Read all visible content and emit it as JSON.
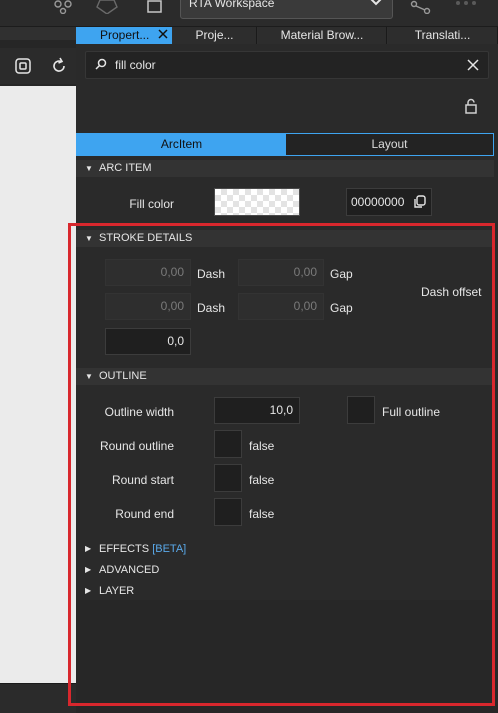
{
  "header": {
    "workspace_label": "RTA Workspace",
    "icons": [
      "network-icon",
      "hexagon-icon",
      "square-icon",
      "chevron-down-icon",
      "share-icon",
      "more-icon"
    ]
  },
  "canvas": {
    "icons": [
      "frame-icon",
      "refresh-icon"
    ]
  },
  "tabs": [
    {
      "label": "Propert..."
    },
    {
      "label": "Proje..."
    },
    {
      "label": "Material Brow..."
    },
    {
      "label": "Translati..."
    }
  ],
  "search": {
    "value": "fill color"
  },
  "subtabs": [
    {
      "label": "ArcItem"
    },
    {
      "label": "Layout"
    }
  ],
  "arc_item": {
    "title": "ARC ITEM",
    "fill_color_label": "Fill color",
    "fill_color_hex": "00000000"
  },
  "stroke_details": {
    "title": "STROKE DETAILS",
    "dash1_value": "0,00",
    "dash_label": "Dash",
    "gap1_value": "0,00",
    "gap_label": "Gap",
    "dash2_value": "0,00",
    "gap2_value": "0,00",
    "dash_offset_label": "Dash offset",
    "dash_offset_value": "0,0"
  },
  "outline": {
    "title": "OUTLINE",
    "outline_width_label": "Outline width",
    "outline_width_value": "10,0",
    "full_outline_label": "Full outline",
    "round_outline_label": "Round outline",
    "round_outline_value": "false",
    "round_start_label": "Round start",
    "round_start_value": "false",
    "round_end_label": "Round end",
    "round_end_value": "false"
  },
  "collapsed_sections": {
    "effects": "EFFECTS",
    "effects_badge": "[BETA]",
    "advanced": "ADVANCED",
    "layer": "LAYER"
  },
  "colors": {
    "accent": "#3ea4f0",
    "highlight": "#d8272d",
    "panel_bg": "#2a2a2a"
  }
}
